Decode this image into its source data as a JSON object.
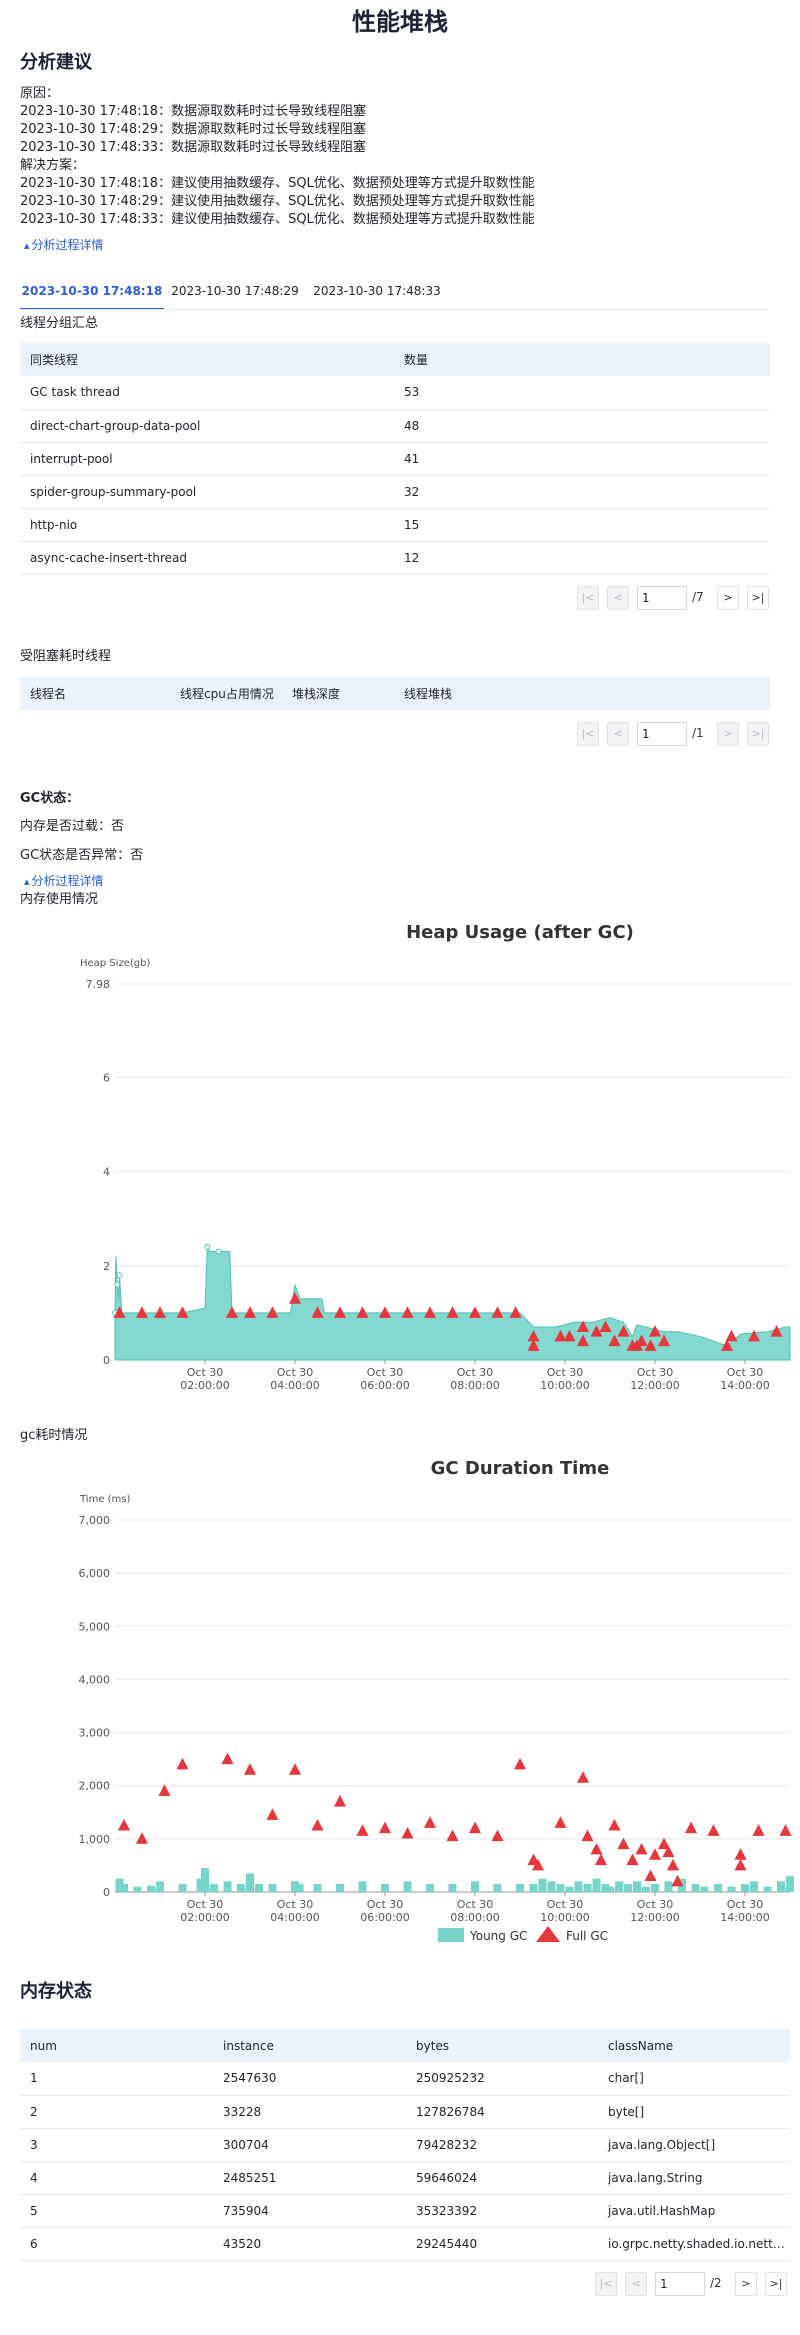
{
  "page_title": "性能堆栈",
  "analysis": {
    "title": "分析建议",
    "reason_label": "原因：",
    "reasons": [
      "2023-10-30 17:48:18：数据源取数耗时过长导致线程阻塞",
      "2023-10-30 17:48:29：数据源取数耗时过长导致线程阻塞",
      "2023-10-30 17:48:33：数据源取数耗时过长导致线程阻塞"
    ],
    "solution_label": "解决方案：",
    "solutions": [
      "2023-10-30 17:48:18：建议使用抽数缓存、SQL优化、数据预处理等方式提升取数性能",
      "2023-10-30 17:48:29：建议使用抽数缓存、SQL优化、数据预处理等方式提升取数性能",
      "2023-10-30 17:48:33：建议使用抽数缓存、SQL优化、数据预处理等方式提升取数性能"
    ],
    "detail_link": "分析过程详情"
  },
  "tabs": [
    "2023-10-30 17:48:18",
    "2023-10-30 17:48:29",
    "2023-10-30 17:48:33"
  ],
  "thread_group": {
    "label": "线程分组汇总",
    "columns": [
      "同类线程",
      "数量"
    ],
    "rows": [
      [
        "GC task thread",
        "53"
      ],
      [
        "direct-chart-group-data-pool",
        "48"
      ],
      [
        "interrupt-pool",
        "41"
      ],
      [
        "spider-group-summary-pool",
        "32"
      ],
      [
        "http-nio",
        "15"
      ],
      [
        "async-cache-insert-thread",
        "12"
      ]
    ],
    "pager": {
      "page": "1",
      "total": "/7"
    }
  },
  "blocked": {
    "label": "受阻塞耗时线程",
    "columns": [
      "线程名",
      "线程cpu占用情况",
      "堆栈深度",
      "线程堆栈"
    ],
    "pager": {
      "page": "1",
      "total": "/1"
    }
  },
  "gc": {
    "title": "GC状态：",
    "memory_overload": "内存是否过载：否",
    "gc_abnormal": "GC状态是否异常：否",
    "detail_link": "分析过程详情",
    "memory_usage_label": "内存使用情况",
    "duration_label": "gc耗时情况"
  },
  "memory": {
    "title": "内存状态",
    "columns": [
      "num",
      "instance",
      "bytes",
      "className"
    ],
    "rows": [
      [
        "1",
        "2547630",
        "250925232",
        "char[]"
      ],
      [
        "2",
        "33228",
        "127826784",
        "byte[]"
      ],
      [
        "3",
        "300704",
        "79428232",
        "java.lang.Object[]"
      ],
      [
        "4",
        "2485251",
        "59646024",
        "java.lang.String"
      ],
      [
        "5",
        "735904",
        "35323392",
        "java.util.HashMap"
      ],
      [
        "6",
        "43520",
        "29245440",
        "io.grpc.netty.shaded.io.netty.util.Recycler$DefaultHandle[]"
      ]
    ],
    "pager": {
      "page": "1",
      "total": "/2"
    }
  },
  "colors": {
    "accent": "#2c5ed8",
    "young": "#76d5ca",
    "full": "#e8373c",
    "header_bg": "#eaf2fc"
  },
  "chart_data": [
    {
      "type": "area",
      "title": "Heap Usage (after GC)",
      "ylabel": "Heap Size(gb)",
      "ylim": [
        0,
        7.98
      ],
      "yticks": [
        "0",
        "2",
        "4",
        "6",
        "7.98"
      ],
      "x_ticks": [
        "Oct 30\n02:00:00",
        "Oct 30\n04:00:00",
        "Oct 30\n06:00:00",
        "Oct 30\n08:00:00",
        "Oct 30\n10:00:00",
        "Oct 30\n12:00:00",
        "Oct 30\n14:00:00"
      ],
      "xlim_hours": [
        0.0,
        15.0
      ],
      "series": [
        {
          "kind": "area",
          "points": [
            [
              0.0,
              1.0
            ],
            [
              0.02,
              2.2
            ],
            [
              0.05,
              1.6
            ],
            [
              0.08,
              1.3
            ],
            [
              0.1,
              1.8
            ],
            [
              0.15,
              1.0
            ],
            [
              1.5,
              1.0
            ],
            [
              2.0,
              1.1
            ],
            [
              2.05,
              2.4
            ],
            [
              2.1,
              2.3
            ],
            [
              2.3,
              2.3
            ],
            [
              2.55,
              2.3
            ],
            [
              2.6,
              1.0
            ],
            [
              3.9,
              1.0
            ],
            [
              4.0,
              1.6
            ],
            [
              4.1,
              1.3
            ],
            [
              4.6,
              1.3
            ],
            [
              4.65,
              1.0
            ],
            [
              9.0,
              1.0
            ],
            [
              9.3,
              0.7
            ],
            [
              9.8,
              0.7
            ],
            [
              10.2,
              0.8
            ],
            [
              10.6,
              0.8
            ],
            [
              11.0,
              0.9
            ],
            [
              11.3,
              0.8
            ],
            [
              11.5,
              0.5
            ],
            [
              11.6,
              0.75
            ],
            [
              12.2,
              0.6
            ],
            [
              12.5,
              0.6
            ],
            [
              13.0,
              0.5
            ],
            [
              13.6,
              0.3
            ],
            [
              13.9,
              0.55
            ],
            [
              14.5,
              0.6
            ],
            [
              14.9,
              0.7
            ],
            [
              15.0,
              0.7
            ]
          ]
        },
        {
          "kind": "full-gc",
          "points": [
            [
              0.1,
              1.0
            ],
            [
              0.6,
              1.0
            ],
            [
              1.0,
              1.0
            ],
            [
              1.5,
              1.0
            ],
            [
              2.6,
              1.0
            ],
            [
              3.0,
              1.0
            ],
            [
              3.5,
              1.0
            ],
            [
              4.0,
              1.3
            ],
            [
              4.5,
              1.0
            ],
            [
              5.0,
              1.0
            ],
            [
              5.5,
              1.0
            ],
            [
              6.0,
              1.0
            ],
            [
              6.5,
              1.0
            ],
            [
              7.0,
              1.0
            ],
            [
              7.5,
              1.0
            ],
            [
              8.0,
              1.0
            ],
            [
              8.5,
              1.0
            ],
            [
              8.9,
              1.0
            ],
            [
              9.3,
              0.5
            ],
            [
              9.3,
              0.3
            ],
            [
              9.9,
              0.5
            ],
            [
              10.1,
              0.5
            ],
            [
              10.4,
              0.7
            ],
            [
              10.4,
              0.4
            ],
            [
              10.7,
              0.6
            ],
            [
              10.9,
              0.7
            ],
            [
              11.1,
              0.4
            ],
            [
              11.3,
              0.6
            ],
            [
              11.5,
              0.3
            ],
            [
              11.6,
              0.3
            ],
            [
              11.7,
              0.4
            ],
            [
              11.9,
              0.3
            ],
            [
              12.0,
              0.6
            ],
            [
              12.2,
              0.4
            ],
            [
              13.6,
              0.3
            ],
            [
              13.7,
              0.5
            ],
            [
              14.2,
              0.5
            ],
            [
              14.7,
              0.6
            ]
          ]
        }
      ]
    },
    {
      "type": "scatter",
      "title": "GC Duration Time",
      "ylabel": "Time (ms)",
      "ylim": [
        0,
        7000
      ],
      "yticks": [
        "0",
        "1,000",
        "2,000",
        "3,000",
        "4,000",
        "5,000",
        "6,000",
        "7,000"
      ],
      "x_ticks": [
        "Oct 30\n02:00:00",
        "Oct 30\n04:00:00",
        "Oct 30\n06:00:00",
        "Oct 30\n08:00:00",
        "Oct 30\n10:00:00",
        "Oct 30\n12:00:00",
        "Oct 30\n14:00:00"
      ],
      "xlim_hours": [
        0.0,
        15.0
      ],
      "legend": [
        "Young GC",
        "Full GC"
      ],
      "series": [
        {
          "name": "Young GC",
          "points": [
            [
              0.1,
              250
            ],
            [
              0.2,
              150
            ],
            [
              0.5,
              100
            ],
            [
              0.8,
              120
            ],
            [
              1.0,
              200
            ],
            [
              1.5,
              150
            ],
            [
              1.9,
              250
            ],
            [
              2.0,
              450
            ],
            [
              2.2,
              150
            ],
            [
              2.5,
              200
            ],
            [
              2.8,
              150
            ],
            [
              3.0,
              350
            ],
            [
              3.2,
              150
            ],
            [
              3.5,
              150
            ],
            [
              4.0,
              200
            ],
            [
              4.1,
              150
            ],
            [
              4.5,
              150
            ],
            [
              5.0,
              150
            ],
            [
              5.5,
              200
            ],
            [
              6.0,
              150
            ],
            [
              6.5,
              200
            ],
            [
              7.0,
              150
            ],
            [
              7.5,
              150
            ],
            [
              8.0,
              200
            ],
            [
              8.5,
              150
            ],
            [
              9.0,
              150
            ],
            [
              9.3,
              150
            ],
            [
              9.5,
              250
            ],
            [
              9.7,
              200
            ],
            [
              9.9,
              150
            ],
            [
              10.1,
              100
            ],
            [
              10.3,
              200
            ],
            [
              10.5,
              150
            ],
            [
              10.7,
              250
            ],
            [
              10.9,
              150
            ],
            [
              11.0,
              100
            ],
            [
              11.2,
              200
            ],
            [
              11.4,
              150
            ],
            [
              11.6,
              200
            ],
            [
              11.8,
              100
            ],
            [
              12.0,
              150
            ],
            [
              12.3,
              200
            ],
            [
              12.6,
              250
            ],
            [
              12.9,
              150
            ],
            [
              13.1,
              100
            ],
            [
              13.4,
              150
            ],
            [
              13.7,
              100
            ],
            [
              14.0,
              150
            ],
            [
              14.2,
              200
            ],
            [
              14.5,
              100
            ],
            [
              14.8,
              200
            ],
            [
              15.0,
              300
            ]
          ]
        },
        {
          "name": "Full GC",
          "points": [
            [
              0.2,
              1250
            ],
            [
              0.6,
              1000
            ],
            [
              1.1,
              1900
            ],
            [
              1.5,
              2400
            ],
            [
              2.5,
              2500
            ],
            [
              3.0,
              2300
            ],
            [
              3.5,
              1450
            ],
            [
              4.0,
              2300
            ],
            [
              4.5,
              1250
            ],
            [
              5.0,
              1700
            ],
            [
              5.5,
              1150
            ],
            [
              6.0,
              1200
            ],
            [
              6.5,
              1100
            ],
            [
              7.0,
              1300
            ],
            [
              7.5,
              1050
            ],
            [
              8.0,
              1200
            ],
            [
              8.5,
              1050
            ],
            [
              9.0,
              2400
            ],
            [
              9.3,
              600
            ],
            [
              9.4,
              500
            ],
            [
              9.9,
              1300
            ],
            [
              10.4,
              2150
            ],
            [
              10.5,
              1050
            ],
            [
              10.7,
              800
            ],
            [
              10.8,
              600
            ],
            [
              11.1,
              1250
            ],
            [
              11.3,
              900
            ],
            [
              11.5,
              600
            ],
            [
              11.7,
              800
            ],
            [
              11.9,
              300
            ],
            [
              12.0,
              700
            ],
            [
              12.2,
              900
            ],
            [
              12.3,
              750
            ],
            [
              12.4,
              500
            ],
            [
              12.5,
              200
            ],
            [
              12.8,
              1200
            ],
            [
              13.3,
              1150
            ],
            [
              13.9,
              700
            ],
            [
              13.9,
              500
            ],
            [
              14.3,
              1150
            ],
            [
              14.9,
              1150
            ]
          ]
        }
      ]
    }
  ]
}
